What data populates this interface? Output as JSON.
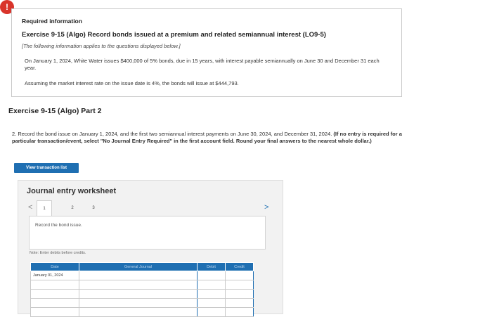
{
  "alert": {
    "glyph": "!"
  },
  "info": {
    "required": "Required information",
    "exercise_title": "Exercise 9-15 (Algo) Record bonds issued at a premium and related semiannual interest (LO9-5)",
    "note": "[The following information applies to the questions displayed below.]",
    "p1": "On January 1, 2024, White Water issues $400,000 of 5% bonds, due in 15 years, with interest payable semiannually on June 30 and December 31 each year.",
    "p2": "Assuming the market interest rate on the issue date is 4%, the bonds will issue at $444,793."
  },
  "part_title": "Exercise 9-15 (Algo) Part 2",
  "instructions": {
    "main": "2. Record the bond issue on January 1, 2024, and the first two semiannual interest payments on June 30, 2024, and December 31, 2024.",
    "bold": "(If no entry is required for a particular transaction/event, select \"No Journal Entry Required\" in the first account field. Round your final answers to the nearest whole dollar.)"
  },
  "view_button": "View transaction list",
  "worksheet": {
    "title": "Journal entry worksheet",
    "prev_glyph": "<",
    "next_glyph": ">",
    "pages": [
      "1",
      "2",
      "3"
    ],
    "description": "Record the bond issue.",
    "note": "Note: Enter debits before credits.",
    "columns": [
      "Date",
      "General Journal",
      "Debit",
      "Credit"
    ],
    "rows": [
      {
        "date": "January 01, 2024",
        "account": "",
        "debit": "",
        "credit": ""
      },
      {
        "date": "",
        "account": "",
        "debit": "",
        "credit": ""
      },
      {
        "date": "",
        "account": "",
        "debit": "",
        "credit": ""
      },
      {
        "date": "",
        "account": "",
        "debit": "",
        "credit": ""
      },
      {
        "date": "",
        "account": "",
        "debit": "",
        "credit": ""
      }
    ]
  },
  "colors": {
    "accent": "#1f6fb2",
    "alert": "#d9342b"
  }
}
